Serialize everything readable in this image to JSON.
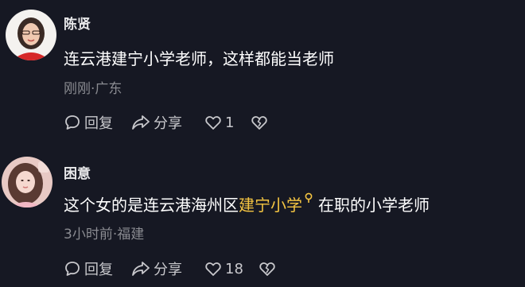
{
  "comments": [
    {
      "username": "陈贤",
      "content_before": "连云港建宁小学老师，这样都能当老师",
      "content_highlight": "",
      "content_after": "",
      "meta": "刚刚·广东",
      "reply_label": "回复",
      "share_label": "分享",
      "like_count": "1"
    },
    {
      "username": "困意",
      "content_before": "这个女的是连云港海州区",
      "content_highlight": "建宁小学",
      "content_after": "在职的小学老师",
      "meta": "3小时前·福建",
      "reply_label": "回复",
      "share_label": "分享",
      "like_count": "18"
    }
  ],
  "colors": {
    "background": "#161823",
    "highlight": "#f5c542",
    "meta": "#8a8b91",
    "action": "#c8c8cc"
  },
  "icons": [
    "reply-icon",
    "share-icon",
    "heart-icon",
    "dislike-icon",
    "search-icon"
  ]
}
